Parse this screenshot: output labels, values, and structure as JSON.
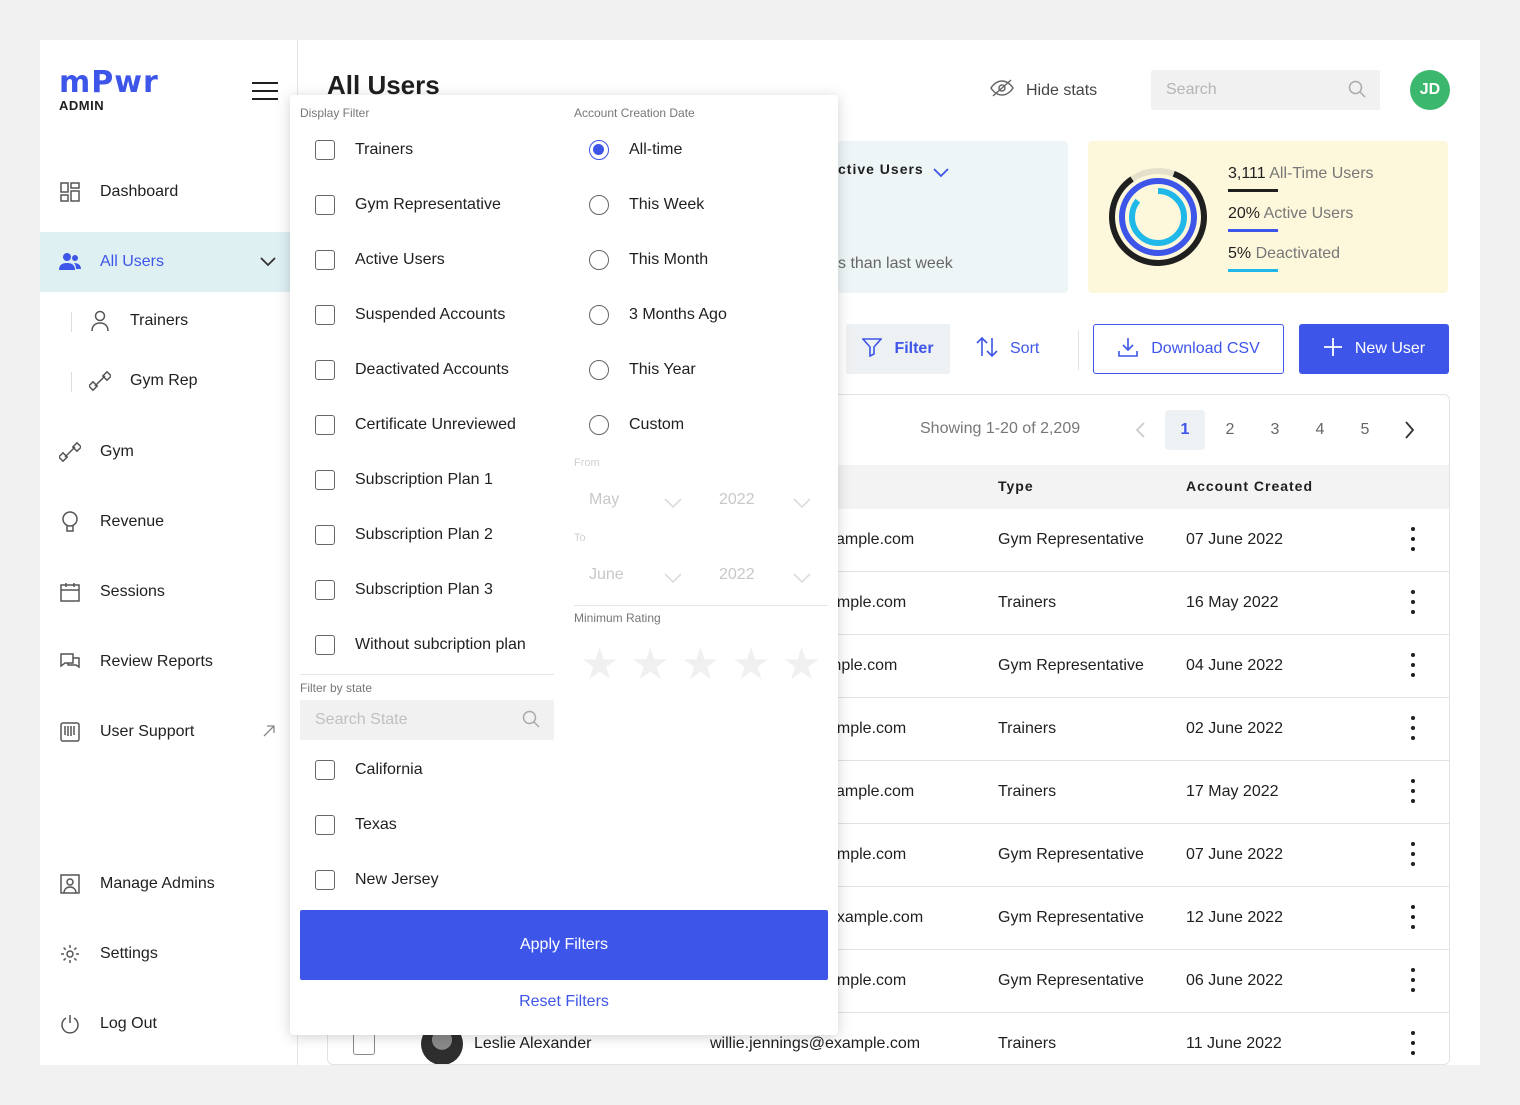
{
  "brand": {
    "logo_text": "mPwr",
    "logo_sub": "ADMIN"
  },
  "sidebar": {
    "items": [
      {
        "label": "Dashboard",
        "icon": "dashboard-icon"
      },
      {
        "label": "All Users",
        "icon": "users-icon"
      },
      {
        "label": "Gym",
        "icon": "dumbbell-icon"
      },
      {
        "label": "Revenue",
        "icon": "lightbulb-icon"
      },
      {
        "label": "Sessions",
        "icon": "calendar-icon"
      },
      {
        "label": "Review Reports",
        "icon": "chat-icon"
      },
      {
        "label": "User Support",
        "icon": "support-icon"
      },
      {
        "label": "Manage Admins",
        "icon": "admin-badge-icon"
      },
      {
        "label": "Settings",
        "icon": "gear-icon"
      },
      {
        "label": "Log Out",
        "icon": "power-icon"
      }
    ],
    "sub_items": [
      {
        "label": "Trainers",
        "icon": "person-icon"
      },
      {
        "label": "Gym Rep",
        "icon": "dumbbell-icon"
      }
    ]
  },
  "header": {
    "title": "All Users",
    "hide_stats": "Hide stats",
    "search_placeholder": "Search",
    "avatar_initials": "JD"
  },
  "stats": {
    "card1_title": "ctive Users",
    "card1_sub": "s than last week",
    "legend": [
      {
        "number": "3,111",
        "label": "All-Time Users",
        "color": "#1f1f1f"
      },
      {
        "number": "20%",
        "label": "Active Users",
        "color": "#3d55e8"
      },
      {
        "number": "5%",
        "label": "Deactivated",
        "color": "#1fb8e8"
      }
    ]
  },
  "toolbar": {
    "filter": "Filter",
    "sort": "Sort",
    "download": "Download CSV",
    "new_user": "New User"
  },
  "table": {
    "showing": "Showing 1-20 of 2,209",
    "pages": [
      "1",
      "2",
      "3",
      "4",
      "5"
    ],
    "current_page": "1",
    "columns": {
      "type": "Type",
      "created": "Account Created"
    },
    "rows": [
      {
        "email": "xample.com",
        "type": "Gym Representative",
        "created": "07 June 2022"
      },
      {
        "email": "ample.com",
        "type": "Trainers",
        "created": "16 May 2022"
      },
      {
        "email": "mple.com",
        "type": "Gym Representative",
        "created": "04 June 2022"
      },
      {
        "email": "ample.com",
        "type": "Trainers",
        "created": "02 June 2022"
      },
      {
        "email": "xample.com",
        "type": "Trainers",
        "created": "17 May 2022"
      },
      {
        "email": "ample.com",
        "type": "Gym Representative",
        "created": "07 June 2022"
      },
      {
        "email": "example.com",
        "type": "Gym Representative",
        "created": "12 June 2022"
      },
      {
        "email": "ample.com",
        "type": "Gym Representative",
        "created": "06 June 2022"
      }
    ],
    "last_row": {
      "name": "Leslie Alexander",
      "email": "willie.jennings@example.com",
      "type": "Trainers",
      "created": "11 June 2022"
    }
  },
  "filter_popup": {
    "display_filter_title": "Display Filter",
    "display_options": [
      "Trainers",
      "Gym Representative",
      "Active Users",
      "Suspended Accounts",
      "Deactivated Accounts",
      "Certificate Unreviewed",
      "Subscription Plan 1",
      "Subscription Plan 2",
      "Subscription Plan 3",
      "Without subcription plan"
    ],
    "date_title": "Account Creation Date",
    "date_options": [
      "All-time",
      "This Week",
      "This Month",
      "3 Months Ago",
      "This Year",
      "Custom"
    ],
    "date_selected": "All-time",
    "from_label": "From",
    "to_label": "To",
    "from_month": "May",
    "from_year": "2022",
    "to_month": "June",
    "to_year": "2022",
    "rating_title": "Minimum Rating",
    "state_title": "Filter by state",
    "state_search_placeholder": "Search State",
    "states": [
      "California",
      "Texas",
      "New Jersey"
    ],
    "apply": "Apply Filters",
    "reset": "Reset Filters"
  }
}
